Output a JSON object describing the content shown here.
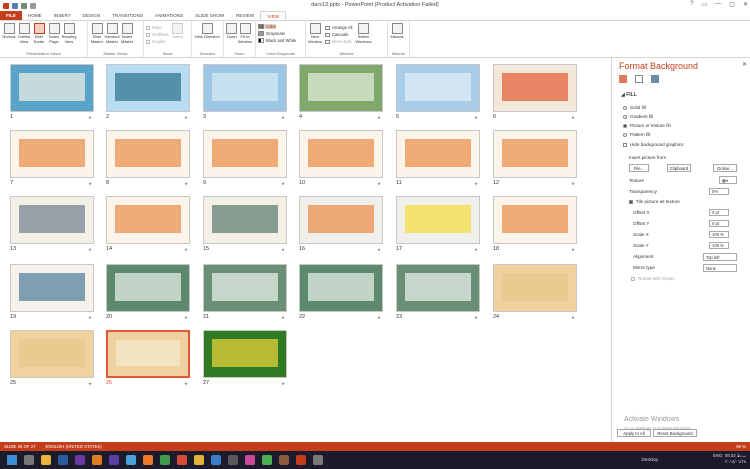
{
  "window": {
    "title": "dars13.pptx - PowerPoint (Product Activation Failed)",
    "controls": [
      "?",
      "▭",
      "—",
      "▢",
      "✕"
    ]
  },
  "tabs": [
    "FILE",
    "HOME",
    "INSERT",
    "DESIGN",
    "TRANSITIONS",
    "ANIMATIONS",
    "SLIDE SHOW",
    "REVIEW",
    "VIEW"
  ],
  "active_tab": "VIEW",
  "ribbon": {
    "presentation_views": {
      "name": "Presentation Views",
      "buttons": [
        "Normal",
        "Outline View",
        "Slide Sorter",
        "Notes Page",
        "Reading View"
      ]
    },
    "master_views": {
      "name": "Master Views",
      "buttons": [
        "Slide Master",
        "Handout Master",
        "Notes Master"
      ]
    },
    "show": {
      "name": "Show",
      "items": [
        "Ruler",
        "Gridlines",
        "Guides"
      ],
      "notes": "Notes"
    },
    "direction": {
      "name": "Direction",
      "button": "View Direction"
    },
    "zoom": {
      "name": "Zoom",
      "buttons": [
        "Zoom",
        "Fit to Window"
      ]
    },
    "color": {
      "name": "Color/Grayscale",
      "options": [
        "Color",
        "Grayscale",
        "Black and White"
      ]
    },
    "window": {
      "name": "Window",
      "new_window": "New Window",
      "items": [
        "Arrange All",
        "Cascade",
        "Move Split"
      ],
      "switch": "Switch Windows"
    },
    "macros": {
      "name": "Macros",
      "button": "Macros"
    }
  },
  "slides": [
    {
      "n": "1",
      "bg": "#5aa3c9",
      "acc": "#f1f1e4"
    },
    {
      "n": "2",
      "bg": "#b8ddf0",
      "acc": "#2a6f8a"
    },
    {
      "n": "3",
      "bg": "#9dc6e4",
      "acc": "#d9ecf7"
    },
    {
      "n": "4",
      "bg": "#7fa86a",
      "acc": "#e6efe0"
    },
    {
      "n": "5",
      "bg": "#a8cdea",
      "acc": "#e3f0f9"
    },
    {
      "n": "6",
      "bg": "#f3e7d9",
      "acc": "#e25b33"
    },
    {
      "n": "7",
      "bg": "#fbf4ea",
      "acc": "#e98b43"
    },
    {
      "n": "8",
      "bg": "#fbf4ea",
      "acc": "#e98b43"
    },
    {
      "n": "9",
      "bg": "#fbf4ea",
      "acc": "#e98b43"
    },
    {
      "n": "10",
      "bg": "#fbf4ea",
      "acc": "#e98b43"
    },
    {
      "n": "11",
      "bg": "#fbf4ea",
      "acc": "#e98b43"
    },
    {
      "n": "12",
      "bg": "#fbf4ea",
      "acc": "#e98b43"
    },
    {
      "n": "13",
      "bg": "#f4efe7",
      "acc": "#6e7f8a"
    },
    {
      "n": "14",
      "bg": "#fbf4ea",
      "acc": "#e98b43"
    },
    {
      "n": "15",
      "bg": "#f4efe7",
      "acc": "#5a7a6c"
    },
    {
      "n": "16",
      "bg": "#f1efe9",
      "acc": "#e98b43"
    },
    {
      "n": "17",
      "bg": "#f1efe9",
      "acc": "#f3df3f"
    },
    {
      "n": "18",
      "bg": "#fbf4ea",
      "acc": "#e98b43"
    },
    {
      "n": "19",
      "bg": "#f6f1ea",
      "acc": "#4f7a9a"
    },
    {
      "n": "20",
      "bg": "#5d8a6e",
      "acc": "#eef3ee"
    },
    {
      "n": "21",
      "bg": "#6a8f75",
      "acc": "#eef3ee"
    },
    {
      "n": "22",
      "bg": "#5d8a6e",
      "acc": "#eef3ee"
    },
    {
      "n": "23",
      "bg": "#6a8f75",
      "acc": "#eef3ee"
    },
    {
      "n": "24",
      "bg": "#efd2a0",
      "acc": "#e8c68a"
    },
    {
      "n": "25",
      "bg": "#efd2a0",
      "acc": "#e8c68a"
    },
    {
      "n": "26",
      "bg": "#efd2a0",
      "acc": "#f7ead0"
    },
    {
      "n": "27",
      "bg": "#2f7a23",
      "acc": "#f2d53c"
    }
  ],
  "selected_slide": "26",
  "format_pane": {
    "title": "Format Background",
    "section": "FILL",
    "fill_options": [
      "Solid fill",
      "Gradient fill",
      "Picture or texture fill",
      "Pattern fill"
    ],
    "selected_fill": "Picture or texture fill",
    "hide_bg": "Hide background graphics",
    "insert_from": "Insert picture from",
    "file_btn": "File...",
    "clipboard_btn": "Clipboard",
    "online_btn": "Online...",
    "texture": "Texture",
    "transparency": "Transparency",
    "transparency_val": "0%",
    "tile": "Tile picture as texture",
    "offset_x": "Offset X",
    "offset_x_val": "0 pt",
    "offset_y": "Offset Y",
    "offset_y_val": "0 pt",
    "scale_x": "Scale X",
    "scale_x_val": "100 %",
    "scale_y": "Scale Y",
    "scale_y_val": "100 %",
    "alignment": "Alignment",
    "alignment_val": "Top left",
    "mirror": "Mirror type",
    "mirror_val": "None",
    "rotate": "Rotate with shape",
    "apply_all": "Apply to All",
    "reset": "Reset Background"
  },
  "watermark": {
    "line1": "Activate Windows",
    "line2": "Go to Settings to activate Windows."
  },
  "status": {
    "slide": "SLIDE 26 OF 27",
    "lang": "ENGLISH (UNITED STATES)",
    "zoom": "66 %"
  },
  "taskbar": {
    "desktop": "Desktop",
    "lang": "ENG",
    "time": "08:32 ب.ظ",
    "date": "۲۰۱۸/۰۱/۲۸"
  }
}
